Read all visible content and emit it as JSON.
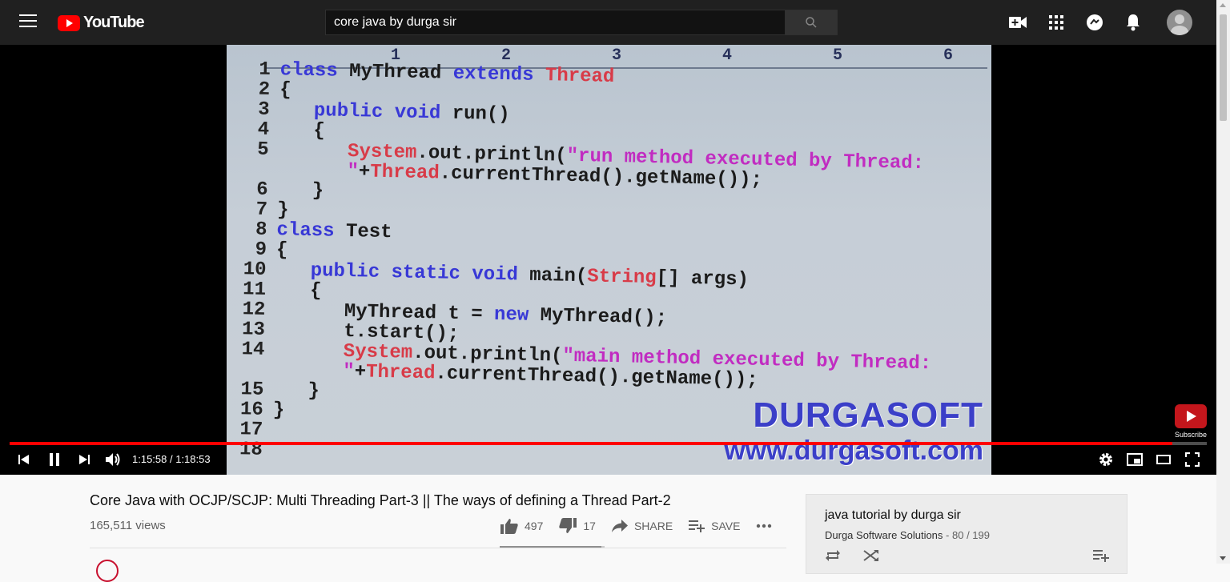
{
  "header": {
    "logo_text": "YouTube",
    "search_value": "core java by durga sir",
    "icons": [
      "menu-icon",
      "search-icon",
      "create-video-icon",
      "apps-icon",
      "messages-icon",
      "notifications-icon",
      "account-avatar"
    ]
  },
  "video": {
    "ruler_marks": [
      "1",
      "2",
      "3",
      "4",
      "5",
      "6"
    ],
    "code_lines": [
      {
        "n": "1",
        "parts": [
          [
            "kw",
            "class "
          ],
          [
            "",
            "MyThread "
          ],
          [
            "kw",
            "extends "
          ],
          [
            "cls",
            "Thread"
          ]
        ]
      },
      {
        "n": "2",
        "parts": [
          [
            "",
            "{"
          ]
        ]
      },
      {
        "n": "3",
        "parts": [
          [
            "",
            "   "
          ],
          [
            "kw",
            "public void "
          ],
          [
            "",
            "run()"
          ]
        ]
      },
      {
        "n": "4",
        "parts": [
          [
            "",
            "   {"
          ]
        ]
      },
      {
        "n": "5",
        "parts": [
          [
            "",
            "      "
          ],
          [
            "cls",
            "System"
          ],
          [
            "",
            ".out.println("
          ],
          [
            "str",
            "\"run method executed by Thread:"
          ]
        ]
      },
      {
        "n": "",
        "parts": [
          [
            "",
            "      "
          ],
          [
            "str",
            "\""
          ],
          [
            "",
            "+"
          ],
          [
            "cls",
            "Thread"
          ],
          [
            "",
            ".currentThread().getName());"
          ]
        ]
      },
      {
        "n": "6",
        "parts": [
          [
            "",
            "   }"
          ]
        ]
      },
      {
        "n": "7",
        "parts": [
          [
            "",
            "}"
          ]
        ]
      },
      {
        "n": "8",
        "parts": [
          [
            "kw",
            "class "
          ],
          [
            "",
            "Test"
          ]
        ]
      },
      {
        "n": "9",
        "parts": [
          [
            "",
            "{"
          ]
        ]
      },
      {
        "n": "10",
        "parts": [
          [
            "",
            "   "
          ],
          [
            "kw",
            "public static void "
          ],
          [
            "",
            "main("
          ],
          [
            "cls",
            "String"
          ],
          [
            "",
            "[] args)"
          ]
        ]
      },
      {
        "n": "11",
        "parts": [
          [
            "",
            "   {"
          ]
        ]
      },
      {
        "n": "12",
        "parts": [
          [
            "",
            "      MyThread t = "
          ],
          [
            "kw",
            "new "
          ],
          [
            "",
            "MyThread();"
          ]
        ]
      },
      {
        "n": "13",
        "parts": [
          [
            "",
            "      t.start();"
          ]
        ]
      },
      {
        "n": "14",
        "parts": [
          [
            "",
            "      "
          ],
          [
            "cls",
            "System"
          ],
          [
            "",
            ".out.println("
          ],
          [
            "str",
            "\"main method executed by Thread:"
          ]
        ]
      },
      {
        "n": "",
        "parts": [
          [
            "",
            "      "
          ],
          [
            "str",
            "\""
          ],
          [
            "",
            "+"
          ],
          [
            "cls",
            "Thread"
          ],
          [
            "",
            ".currentThread().getName());"
          ]
        ]
      },
      {
        "n": "15",
        "parts": [
          [
            "",
            "   }"
          ]
        ]
      },
      {
        "n": "16",
        "parts": [
          [
            "",
            "}"
          ]
        ]
      },
      {
        "n": "17",
        "parts": [
          [
            "",
            ""
          ]
        ]
      },
      {
        "n": "18",
        "parts": [
          [
            "",
            ""
          ]
        ]
      }
    ],
    "watermark_name": "DURGASOFT",
    "watermark_url": "www.durgasoft.com",
    "subscribe_label": "Subscribe",
    "progress": 0.971,
    "time_current": "1:15:58",
    "time_total": "1:18:53",
    "time_display": "1:15:58 / 1:18:53"
  },
  "info": {
    "title": "Core Java with OCJP/SCJP: Multi Threading Part-3 || The ways of defining a Thread Part-2",
    "views": "165,511 views",
    "likes": "497",
    "dislikes": "17",
    "like_ratio": 0.967,
    "share_label": "SHARE",
    "save_label": "SAVE"
  },
  "playlist": {
    "title": "java tutorial by durga sir",
    "channel": "Durga Software Solutions",
    "position": "80 / 199"
  },
  "colors": {
    "masthead_bg": "#202020",
    "progress_red": "#ff0000",
    "keyword_blue": "#3838d6",
    "class_red": "#d83b48",
    "string_magenta": "#c12cc1"
  }
}
